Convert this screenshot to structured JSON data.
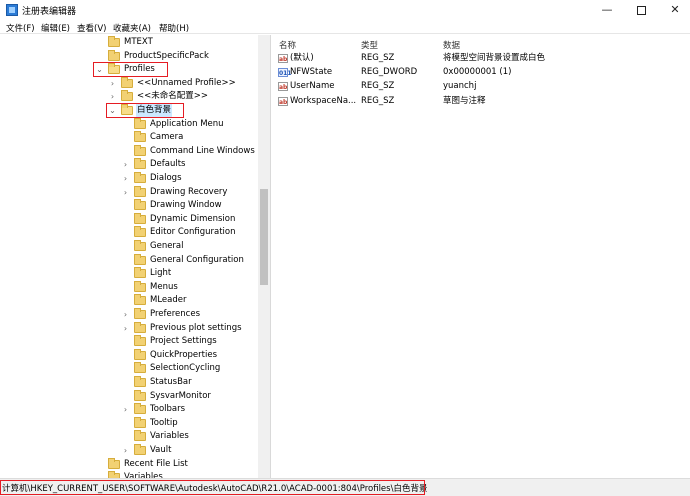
{
  "window": {
    "title": "注册表编辑器",
    "minimize_glyph": "—",
    "close_glyph": "✕"
  },
  "menu": [
    "文件(F)",
    "编辑(E)",
    "查看(V)",
    "收藏夹(A)",
    "帮助(H)"
  ],
  "tree": [
    {
      "label": "MTEXT",
      "chevron": "",
      "selected": false,
      "highlighted": false
    },
    {
      "label": "ProductSpecificPack",
      "chevron": "",
      "selected": false,
      "highlighted": false
    },
    {
      "label": "Profiles",
      "chevron": "⌄",
      "selected": false,
      "highlighted": true
    },
    {
      "label": "<<Unnamed Profile>>",
      "chevron": "›",
      "selected": false,
      "highlighted": false
    },
    {
      "label": "<<未命名配置>>",
      "chevron": "›",
      "selected": false,
      "highlighted": false
    },
    {
      "label": "白色背景",
      "chevron": "⌄",
      "selected": true,
      "highlighted": true
    },
    {
      "label": "Application Menu",
      "chevron": "",
      "selected": false,
      "highlighted": false
    },
    {
      "label": "Camera",
      "chevron": "",
      "selected": false,
      "highlighted": false
    },
    {
      "label": "Command Line Windows",
      "chevron": "",
      "selected": false,
      "highlighted": false
    },
    {
      "label": "Defaults",
      "chevron": "›",
      "selected": false,
      "highlighted": false
    },
    {
      "label": "Dialogs",
      "chevron": "›",
      "selected": false,
      "highlighted": false
    },
    {
      "label": "Drawing Recovery",
      "chevron": "›",
      "selected": false,
      "highlighted": false
    },
    {
      "label": "Drawing Window",
      "chevron": "",
      "selected": false,
      "highlighted": false
    },
    {
      "label": "Dynamic Dimension",
      "chevron": "",
      "selected": false,
      "highlighted": false
    },
    {
      "label": "Editor Configuration",
      "chevron": "",
      "selected": false,
      "highlighted": false
    },
    {
      "label": "General",
      "chevron": "",
      "selected": false,
      "highlighted": false
    },
    {
      "label": "General Configuration",
      "chevron": "",
      "selected": false,
      "highlighted": false
    },
    {
      "label": "Light",
      "chevron": "",
      "selected": false,
      "highlighted": false
    },
    {
      "label": "Menus",
      "chevron": "",
      "selected": false,
      "highlighted": false
    },
    {
      "label": "MLeader",
      "chevron": "",
      "selected": false,
      "highlighted": false
    },
    {
      "label": "Preferences",
      "chevron": "›",
      "selected": false,
      "highlighted": false
    },
    {
      "label": "Previous plot settings",
      "chevron": "›",
      "selected": false,
      "highlighted": false
    },
    {
      "label": "Project Settings",
      "chevron": "",
      "selected": false,
      "highlighted": false
    },
    {
      "label": "QuickProperties",
      "chevron": "",
      "selected": false,
      "highlighted": false
    },
    {
      "label": "SelectionCycling",
      "chevron": "",
      "selected": false,
      "highlighted": false
    },
    {
      "label": "StatusBar",
      "chevron": "",
      "selected": false,
      "highlighted": false
    },
    {
      "label": "SysvarMonitor",
      "chevron": "",
      "selected": false,
      "highlighted": false
    },
    {
      "label": "Toolbars",
      "chevron": "›",
      "selected": false,
      "highlighted": false
    },
    {
      "label": "Tooltip",
      "chevron": "",
      "selected": false,
      "highlighted": false
    },
    {
      "label": "Variables",
      "chevron": "",
      "selected": false,
      "highlighted": false
    },
    {
      "label": "Vault",
      "chevron": "›",
      "selected": false,
      "highlighted": false
    },
    {
      "label": "Recent File List",
      "chevron": "",
      "selected": false,
      "highlighted": false
    },
    {
      "label": "Variables",
      "chevron": "",
      "selected": false,
      "highlighted": false
    }
  ],
  "values": {
    "headers": [
      "名称",
      "类型",
      "数据"
    ],
    "rows": [
      {
        "icon": "string-value-icon",
        "glyph": "ab",
        "name": "(默认)",
        "type": "REG_SZ",
        "data": "将模型空间背景设置成白色"
      },
      {
        "icon": "dword-value-icon",
        "glyph": "011",
        "name": "NFWState",
        "type": "REG_DWORD",
        "data": "0x00000001 (1)"
      },
      {
        "icon": "string-value-icon",
        "glyph": "ab",
        "name": "UserName",
        "type": "REG_SZ",
        "data": "yuanchj"
      },
      {
        "icon": "string-value-icon",
        "glyph": "ab",
        "name": "WorkspaceNa...",
        "type": "REG_SZ",
        "data": "草图与注释"
      }
    ]
  },
  "status": {
    "path": "计算机\\HKEY_CURRENT_USER\\SOFTWARE\\Autodesk\\AutoCAD\\R21.0\\ACAD-0001:804\\Profiles\\白色背景"
  },
  "colors": {
    "highlight": "#e51c23",
    "selection": "#cce8ff",
    "folder": "#f2d173"
  }
}
